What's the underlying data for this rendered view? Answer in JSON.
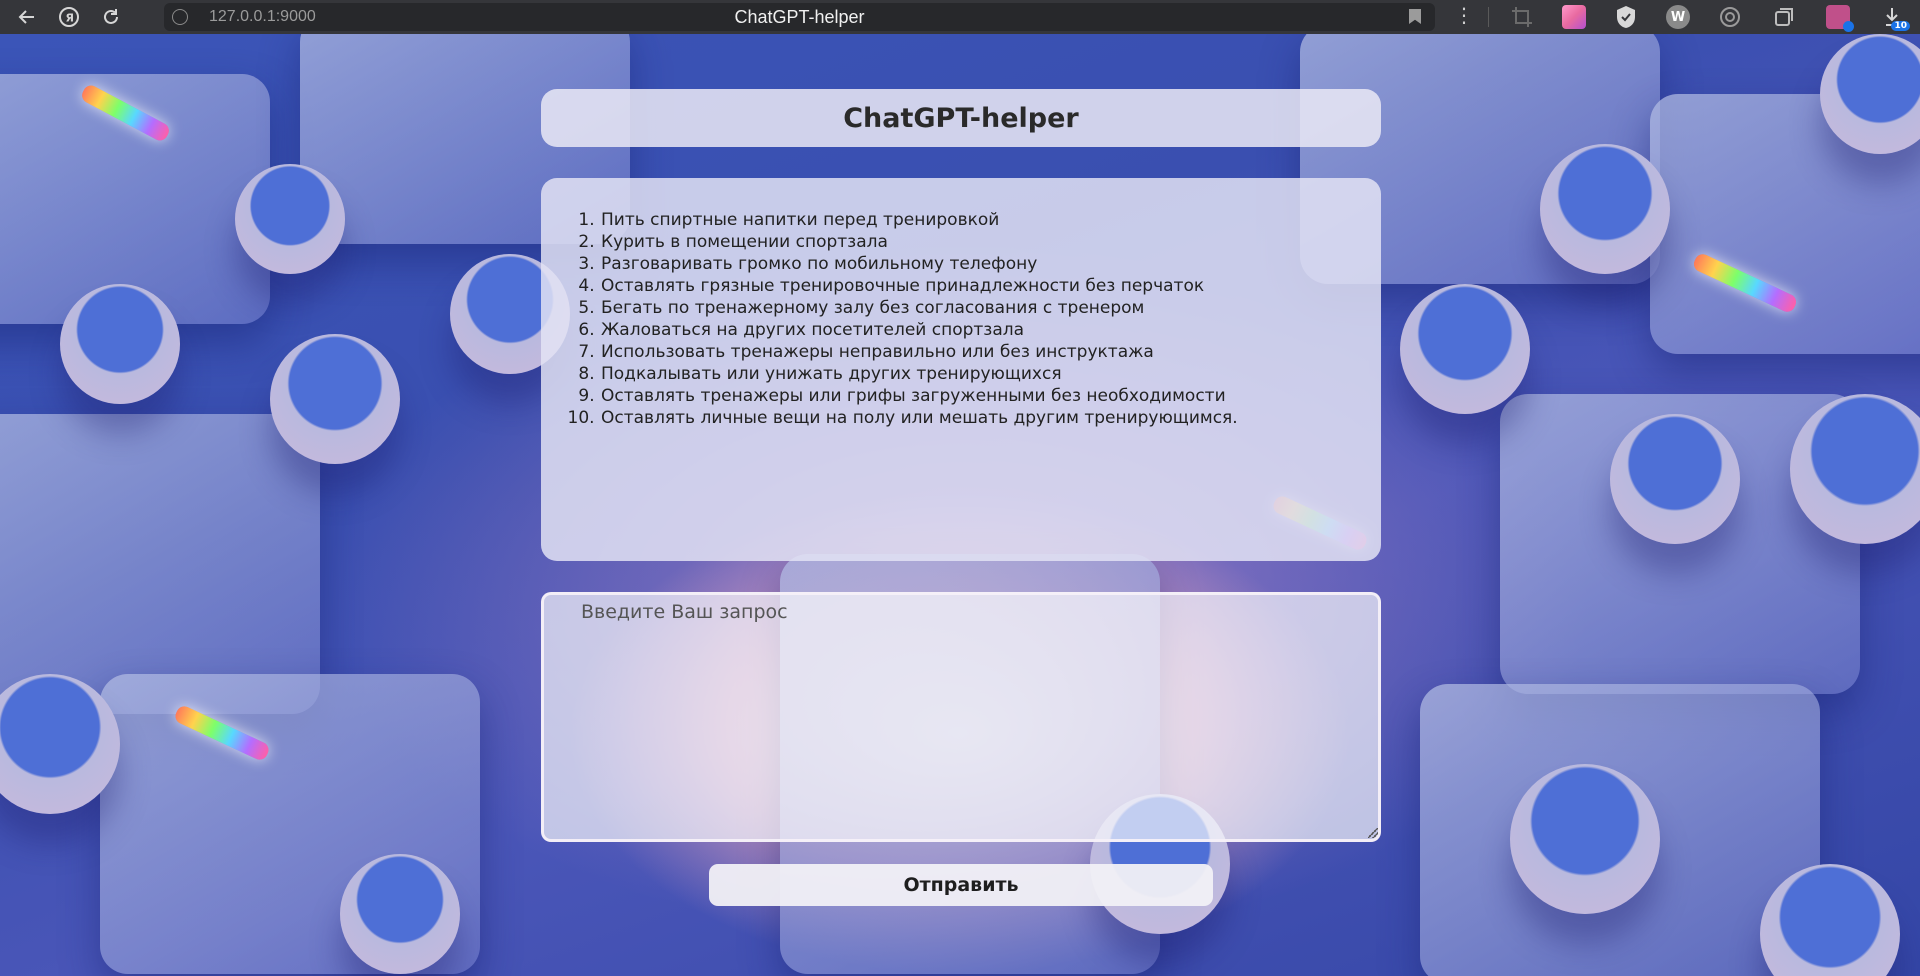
{
  "browser": {
    "url": "127.0.0.1:9000",
    "tab_title": "ChatGPT-helper",
    "nav_icons": [
      "back-arrow-icon",
      "yandex-icon",
      "reload-icon"
    ],
    "menu_label": "⋮",
    "extensions": [
      {
        "name": "crop-icon",
        "label": "",
        "color": "#6b6b6b"
      },
      {
        "name": "gradient-extension-icon",
        "label": "",
        "color": "#e86aa0"
      },
      {
        "name": "shield-icon",
        "label": "",
        "color": "#d8d8d8"
      },
      {
        "name": "w-extension-icon",
        "label": "W",
        "color": "#8a8a8a"
      },
      {
        "name": "spiral-icon",
        "label": "",
        "color": "#9a9a9a"
      },
      {
        "name": "collections-icon",
        "label": "",
        "color": "#bdbdbd"
      },
      {
        "name": "profile-extension-icon",
        "label": "",
        "color": "#c0508a"
      },
      {
        "name": "downloads-icon",
        "label": "10",
        "color": "#1a73e8"
      }
    ]
  },
  "app": {
    "title": "ChatGPT-helper",
    "response_items": [
      "Пить спиртные напитки перед тренировкой",
      "Курить в помещении спортзала",
      "Разговаривать громко по мобильному телефону",
      "Оставлять грязные тренировочные принадлежности без перчаток",
      "Бегать по тренажерному залу без согласования с тренером",
      "Жаловаться на других посетителей спортзала",
      "Использовать тренажеры неправильно или без инструктажа",
      "Подкалывать или унижать других тренирующихся",
      "Оставлять тренажеры или грифы загруженными без необходимости",
      "Оставлять личные вещи на полу или мешать другим тренирующимся."
    ],
    "query": {
      "placeholder": "Введите Ваш запрос",
      "value": ""
    },
    "submit_label": "Отправить"
  }
}
